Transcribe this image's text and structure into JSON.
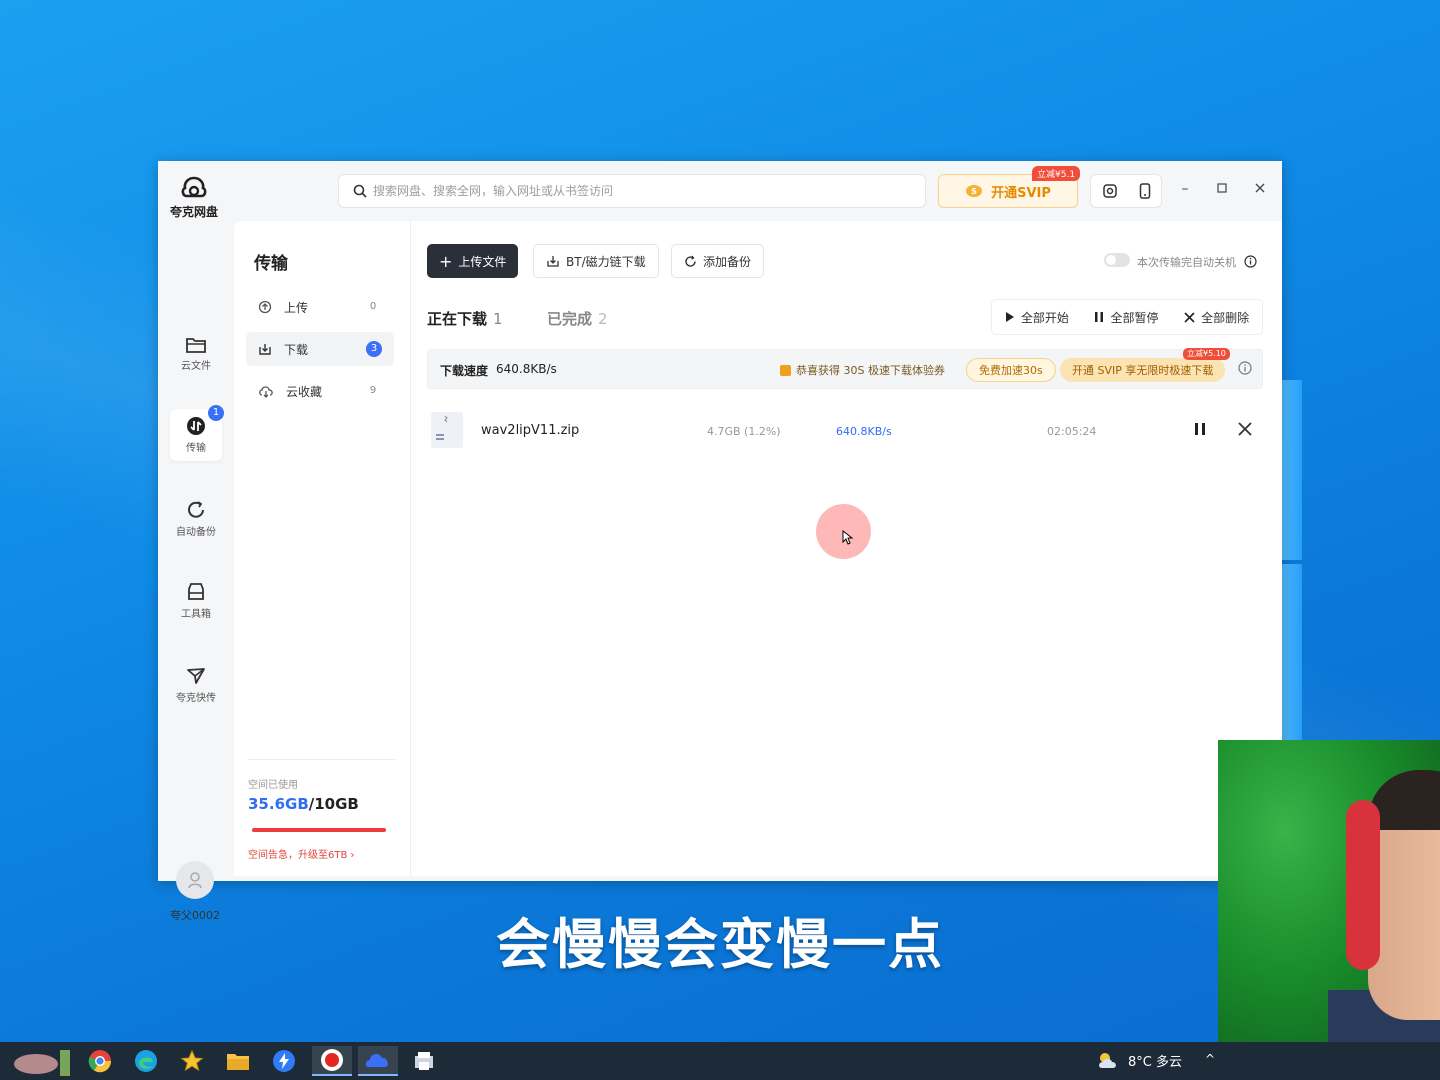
{
  "app": {
    "logo_text": "夸克网盘",
    "search_placeholder": "搜索网盘、搜索全网，输入网址或从书签访问",
    "svip_label": "开通SVIP",
    "svip_badge": "立减¥5.1"
  },
  "rail": {
    "items": [
      {
        "label": "云文件",
        "icon": "folder-icon"
      },
      {
        "label": "传输",
        "icon": "transfer-icon",
        "badge": "1"
      },
      {
        "label": "自动备份",
        "icon": "sync-icon"
      },
      {
        "label": "工具箱",
        "icon": "toolbox-icon"
      },
      {
        "label": "夸克快传",
        "icon": "send-icon"
      }
    ],
    "username": "夸父0002"
  },
  "panel": {
    "title": "传输",
    "nav": [
      {
        "label": "上传",
        "count": "0"
      },
      {
        "label": "下载",
        "count": "3"
      },
      {
        "label": "云收藏",
        "count": "9"
      }
    ],
    "storage_label": "空间已使用",
    "storage_used": "35.6GB",
    "storage_sep": "/",
    "storage_total": "10GB",
    "storage_warn": "空间告急，升级至6TB",
    "storage_warn_arrow": "›"
  },
  "main": {
    "upload_btn": "上传文件",
    "bt_btn": "BT/磁力链下载",
    "backup_btn": "添加备份",
    "auto_shutdown": "本次传输完自动关机",
    "tab_downloading": "正在下载",
    "tab_downloading_count": "1",
    "tab_done": "已完成",
    "tab_done_count": "2",
    "start_all": "全部开始",
    "pause_all": "全部暂停",
    "delete_all": "全部删除",
    "speed_label": "下载速度",
    "speed_value": "640.8KB/s",
    "promo_text": "恭喜获得 30S 极速下载体验券",
    "free_boost": "免费加速30s",
    "svip_promo": "开通 SVIP 享无限时极速下载",
    "svip_promo_badge": "立减¥5.10",
    "file": {
      "name": "wav2lipV11.zip",
      "size": "4.7GB (1.2%)",
      "speed": "640.8KB/s",
      "time": "02:05:24"
    }
  },
  "subtitle": "会慢慢会变慢一点",
  "taskbar": {
    "weather": "8°C 多云",
    "apps": [
      "hippo-icon",
      "chrome-icon",
      "edge-icon",
      "star-icon",
      "explorer-icon",
      "feishu-icon",
      "record-icon",
      "quark-icon",
      "tool-icon"
    ]
  }
}
